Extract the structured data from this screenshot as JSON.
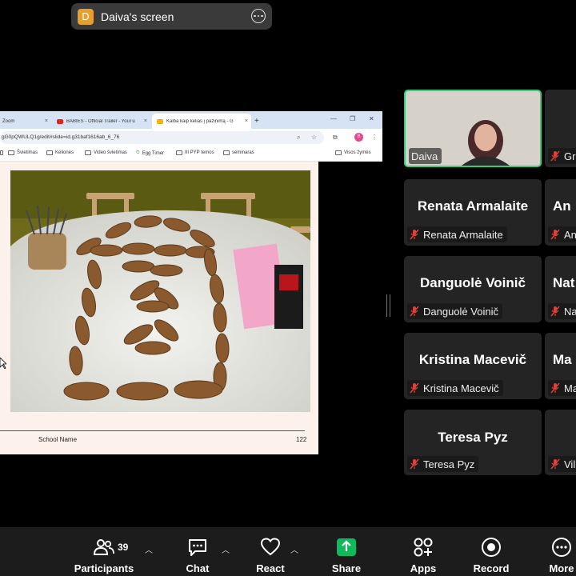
{
  "share_label": {
    "avatar_letter": "D",
    "title": "Daiva's screen",
    "accent": "#e7a02b"
  },
  "browser": {
    "tabs": [
      {
        "label": "Zoom",
        "close": "×"
      },
      {
        "label": "BABIES - Official Trailer - YouTu",
        "close": "×"
      },
      {
        "label": "Kalba kaip kelias į pažinimą - G",
        "close": "×"
      }
    ],
    "new_tab": "+",
    "url": "gG0pQWULQ1g/edit#slide=id.g31baf1616ab_6_76",
    "profile_letter": "B",
    "bookmarks": [
      "Švietimas",
      "Kelionės",
      "Video švietimas",
      "Egg Timer",
      "III PYP temos",
      "seminaras"
    ],
    "all_bookmarks": "Visos žymės"
  },
  "slide": {
    "footer": "School Name",
    "page": "122"
  },
  "gallery": {
    "active_speaker": "Daiva",
    "tiles": [
      {
        "big": "",
        "tag": "Daiva"
      },
      {
        "big": "",
        "tag": "Gre"
      },
      {
        "big": "Renata Armalaite",
        "tag": "Renata Armalaite"
      },
      {
        "big": "An",
        "tag": "An"
      },
      {
        "big": "Danguolė Voinič",
        "tag": "Danguolė Voinič"
      },
      {
        "big": "Nat",
        "tag": "Na"
      },
      {
        "big": "Kristina Macevič",
        "tag": "Kristina Macevič"
      },
      {
        "big": "Ma",
        "tag": "Ma"
      },
      {
        "big": "Teresa Pyz",
        "tag": "Teresa Pyz"
      },
      {
        "big": "",
        "tag": "Vil"
      }
    ],
    "active_border": "#2fd07a",
    "muted_color": "#e0403a"
  },
  "toolbar": {
    "participants_label": "Participants",
    "participants_count": "39",
    "chat_label": "Chat",
    "react_label": "React",
    "share_label": "Share",
    "share_color": "#10b85c",
    "apps_label": "Apps",
    "record_label": "Record",
    "more_label": "More"
  }
}
